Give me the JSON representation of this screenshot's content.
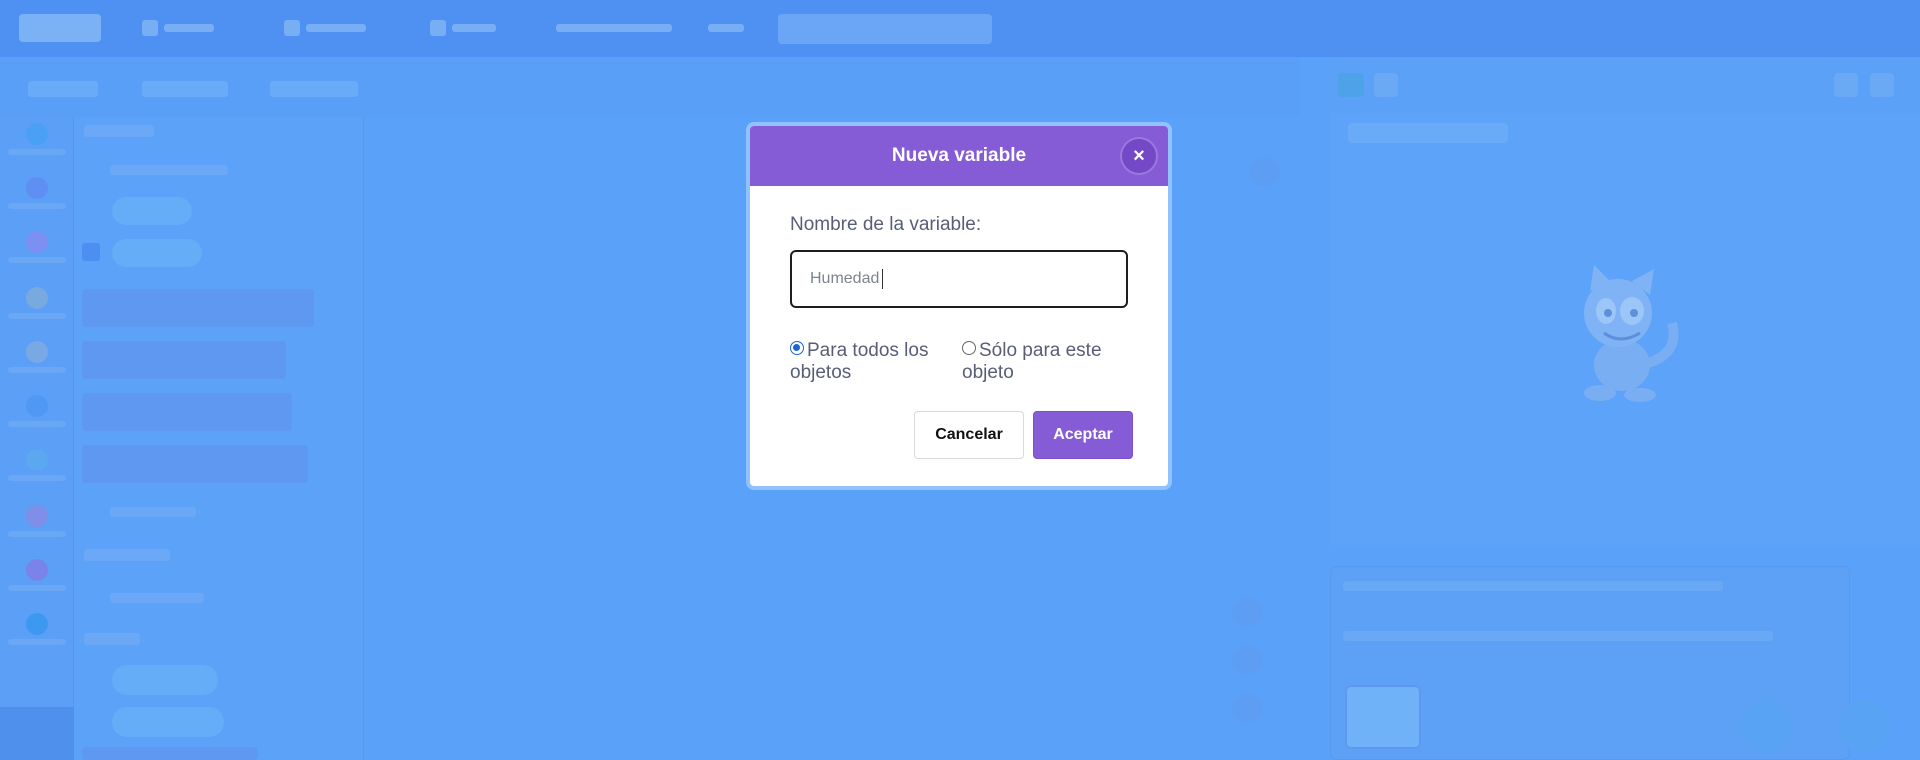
{
  "modal": {
    "title": "Nueva variable",
    "close_icon": "×",
    "field_label": "Nombre de la variable:",
    "input_value": "Humedad",
    "radio_all_label": "Para todos los objetos",
    "radio_this_label": "Sólo para este objeto",
    "radio_all_selected": true,
    "cancel_label": "Cancelar",
    "accept_label": "Aceptar"
  },
  "colors": {
    "modal_header": "#855cd6",
    "accept_button": "#855cd6",
    "overlay": "#5aa2f9"
  },
  "icons": {
    "close": "close-icon",
    "sprite": "cat-sprite-icon"
  }
}
